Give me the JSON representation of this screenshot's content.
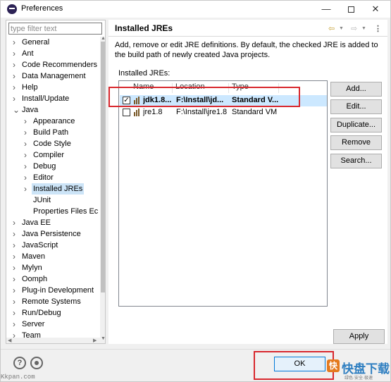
{
  "window": {
    "title": "Preferences",
    "minimize": "—",
    "close": "✕"
  },
  "sidebar": {
    "filter_placeholder": "type filter text",
    "items": [
      {
        "label": "General",
        "twisty": ">"
      },
      {
        "label": "Ant",
        "twisty": ">"
      },
      {
        "label": "Code Recommenders",
        "twisty": ">"
      },
      {
        "label": "Data Management",
        "twisty": ">"
      },
      {
        "label": "Help",
        "twisty": ">"
      },
      {
        "label": "Install/Update",
        "twisty": ">"
      },
      {
        "label": "Java",
        "twisty": "v"
      },
      {
        "label": "Appearance",
        "twisty": ">"
      },
      {
        "label": "Build Path",
        "twisty": ">"
      },
      {
        "label": "Code Style",
        "twisty": ">"
      },
      {
        "label": "Compiler",
        "twisty": ">"
      },
      {
        "label": "Debug",
        "twisty": ">"
      },
      {
        "label": "Editor",
        "twisty": ">"
      },
      {
        "label": "Installed JREs",
        "twisty": ">"
      },
      {
        "label": "JUnit",
        "twisty": ""
      },
      {
        "label": "Properties Files Ec",
        "twisty": ""
      },
      {
        "label": "Java EE",
        "twisty": ">"
      },
      {
        "label": "Java Persistence",
        "twisty": ">"
      },
      {
        "label": "JavaScript",
        "twisty": ">"
      },
      {
        "label": "Maven",
        "twisty": ">"
      },
      {
        "label": "Mylyn",
        "twisty": ">"
      },
      {
        "label": "Oomph",
        "twisty": ">"
      },
      {
        "label": "Plug-in Development",
        "twisty": ">"
      },
      {
        "label": "Remote Systems",
        "twisty": ">"
      },
      {
        "label": "Run/Debug",
        "twisty": ">"
      },
      {
        "label": "Server",
        "twisty": ">"
      },
      {
        "label": "Team",
        "twisty": ">"
      }
    ]
  },
  "page": {
    "title": "Installed JREs",
    "description": "Add, remove or edit JRE definitions. By default, the checked JRE is added to the build path of newly created Java projects.",
    "list_label": "Installed JREs:",
    "columns": [
      "Name",
      "Location",
      "Type"
    ],
    "rows": [
      {
        "name": "jdk1.8...",
        "location": "F:\\Install\\jd...",
        "type": "Standard V...",
        "checked": true
      },
      {
        "name": "jre1.8",
        "location": "F:\\Install\\jre1.8",
        "type": "Standard VM",
        "checked": false
      }
    ],
    "buttons": {
      "add": "Add...",
      "edit": "Edit...",
      "duplicate": "Duplicate...",
      "remove": "Remove",
      "search": "Search..."
    },
    "apply": "Apply"
  },
  "footer": {
    "help": "?",
    "ok": "OK"
  },
  "watermark": {
    "left": "Kkpan.com",
    "brand": "快盘下载",
    "brand_sub": "绿色·安全·极速"
  },
  "colors": {
    "selection": "#cce4f7",
    "annotation_red": "#d8282e",
    "ok_border": "#0078d7"
  }
}
